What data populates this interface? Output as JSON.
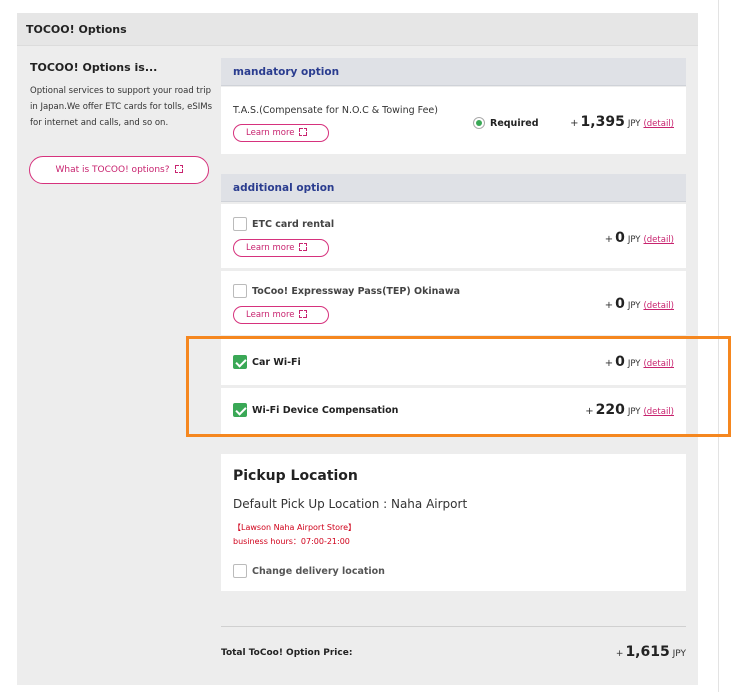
{
  "panel": {
    "title": "TOCOO! Options"
  },
  "sidebar": {
    "title": "TOCOO! Options is...",
    "description": "Optional services to support your road trip in Japan.We offer ETC cards for tolls, eSIMs for internet and calls, and so on.",
    "what_button": "What is TOCOO! options?"
  },
  "mandatory": {
    "heading": "mandatory option",
    "item": {
      "label": "T.A.S.(Compensate for N.O.C & Towing Fee)",
      "learn_more": "Learn more",
      "status": "Required",
      "plus": "+",
      "amount": "1,395",
      "currency": "JPY",
      "detail": "(detail)"
    }
  },
  "additional": {
    "heading": "additional option",
    "items": [
      {
        "label": "ETC card rental",
        "learn_more": "Learn more",
        "checked": false,
        "plus": "+",
        "amount": "0",
        "currency": "JPY",
        "detail": "(detail)"
      },
      {
        "label": "ToCoo! Expressway Pass(TEP) Okinawa",
        "learn_more": "Learn more",
        "checked": false,
        "plus": "+",
        "amount": "0",
        "currency": "JPY",
        "detail": "(detail)"
      },
      {
        "label": "Car Wi-Fi",
        "checked": true,
        "plus": "+",
        "amount": "0",
        "currency": "JPY",
        "detail": "(detail)"
      },
      {
        "label": "Wi-Fi Device Compensation",
        "checked": true,
        "plus": "+",
        "amount": "220",
        "currency": "JPY",
        "detail": "(detail)"
      }
    ]
  },
  "pickup": {
    "title": "Pickup Location",
    "default_location": "Default Pick Up Location : Naha Airport",
    "store": "【Lawson Naha Airport Store】",
    "hours": "business hours：07:00-21:00",
    "change_label": "Change delivery location"
  },
  "total": {
    "label": "Total ToCoo! Option Price:",
    "plus": "+",
    "amount": "1,615",
    "currency": "JPY"
  },
  "colors": {
    "accent_pink": "#c8236f",
    "heading_blue": "#2a3c8f",
    "check_green": "#3aa856",
    "highlight_orange": "#f5871f"
  }
}
